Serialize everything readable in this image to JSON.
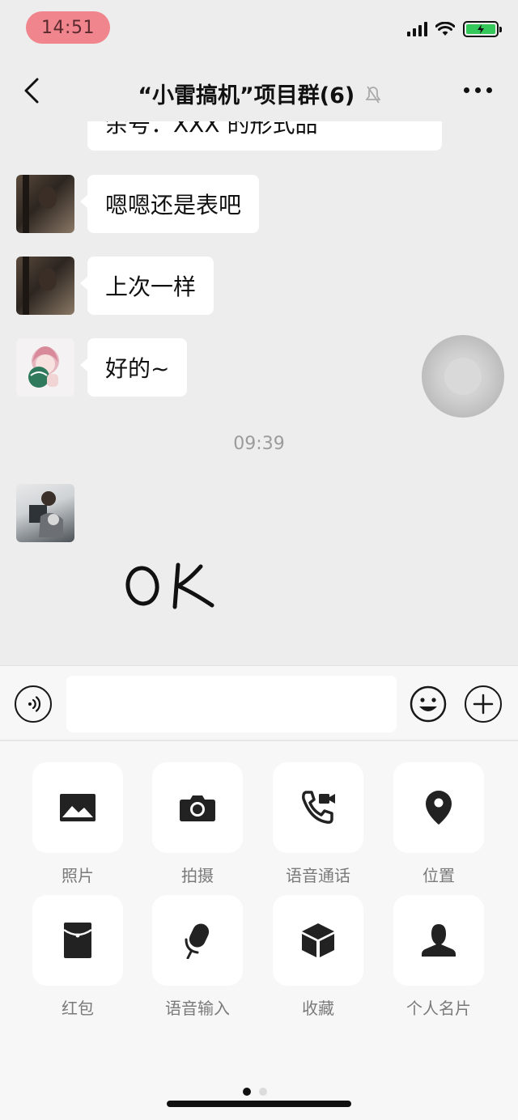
{
  "status_bar": {
    "time": "14:51"
  },
  "nav": {
    "title": "“小雷搞机”项目群(6)"
  },
  "chat": {
    "previous_partial_text": "余号：XXX 的形式品",
    "messages": [
      {
        "text": "嗯嗯还是表吧"
      },
      {
        "text": "上次一样"
      },
      {
        "text": "好的~"
      }
    ],
    "timestamp": "09:39",
    "sticker_text": "OK"
  },
  "input": {
    "value": "",
    "placeholder": ""
  },
  "tools": [
    {
      "label": "照片",
      "icon": "photo-icon"
    },
    {
      "label": "拍摄",
      "icon": "camera-icon"
    },
    {
      "label": "语音通话",
      "icon": "voice-call-icon"
    },
    {
      "label": "位置",
      "icon": "location-icon"
    },
    {
      "label": "红包",
      "icon": "red-packet-icon"
    },
    {
      "label": "语音输入",
      "icon": "microphone-icon"
    },
    {
      "label": "收藏",
      "icon": "favorites-icon"
    },
    {
      "label": "个人名片",
      "icon": "contact-card-icon"
    }
  ],
  "pager": {
    "pages": 2,
    "current": 1
  },
  "colors": {
    "background": "#ededed",
    "bubble": "#ffffff",
    "icon": "#222222",
    "battery": "#34c759"
  }
}
